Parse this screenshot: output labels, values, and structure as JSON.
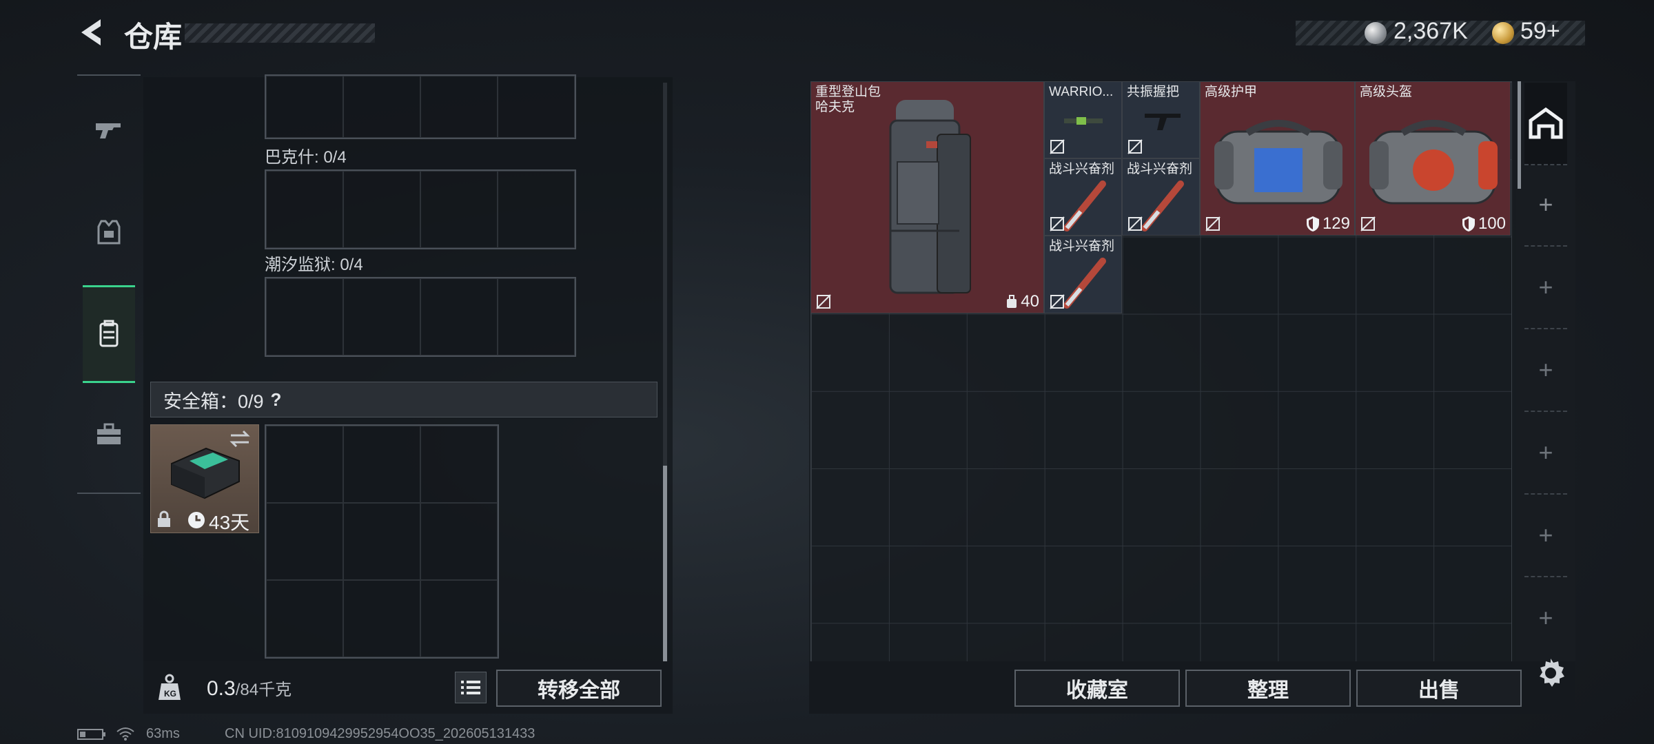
{
  "header": {
    "title": "仓库"
  },
  "currency": {
    "silver": "2,367K",
    "gold": "59+"
  },
  "left": {
    "slots": [
      {
        "label": "巴克什: 0/4"
      },
      {
        "label": "潮汐监狱: 0/4"
      }
    ],
    "safebox": {
      "label": "安全箱：0/9",
      "help": "?",
      "timer": "43天"
    },
    "weight": {
      "current": "0.3",
      "capacity": "/84千克"
    },
    "transfer_label": "转移全部"
  },
  "items": {
    "backpack": {
      "name": "重型登山包\n哈夫克",
      "stat": "40"
    },
    "warrior": {
      "name": "WARRIO..."
    },
    "grip": {
      "name": "共振握把"
    },
    "stim1": {
      "name": "战斗兴奋剂"
    },
    "stim2": {
      "name": "战斗兴奋剂"
    },
    "stim3": {
      "name": "战斗兴奋剂"
    },
    "armor": {
      "name": "高级护甲",
      "stat": "129"
    },
    "helmet": {
      "name": "高级头盔",
      "stat": "100"
    }
  },
  "buttons": {
    "collection": "收藏室",
    "sort": "整理",
    "sell": "出售"
  },
  "status": {
    "ping": "63ms",
    "uid": "CN UID:8109109429952954OO35_202605131433"
  },
  "colors": {
    "accent": "#3ad38d",
    "item_red": "#5a2a30"
  }
}
